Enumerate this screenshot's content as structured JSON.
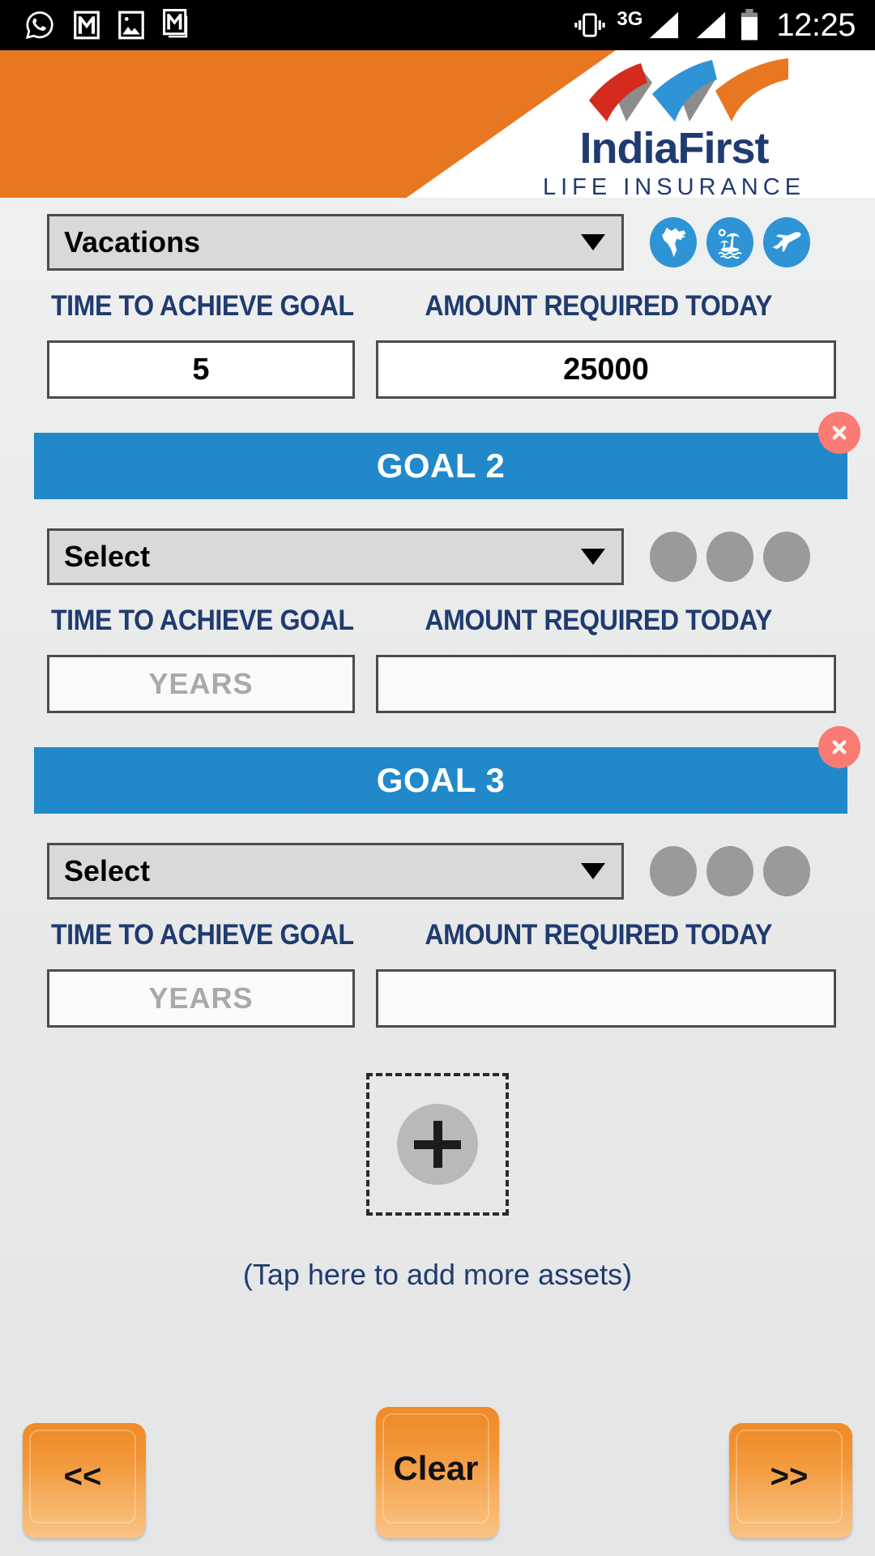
{
  "statusbar": {
    "time": "12:25",
    "network": "3G",
    "left_icons": [
      "whatsapp-icon",
      "gmail-icon",
      "gallery-icon",
      "gmail-icon"
    ],
    "right_icons": [
      "vibrate-icon",
      "signal-icon",
      "signal-icon",
      "battery-icon"
    ]
  },
  "header": {
    "brand_name": "IndiaFirst",
    "brand_sub": "LIFE INSURANCE",
    "accent_orange": "#e87722",
    "accent_navy": "#1f3b70",
    "logo_colors": [
      "#d52b1e",
      "#2f94d6",
      "#e87722",
      "#8c8c8c"
    ]
  },
  "labels": {
    "time_to_achieve": "TIME TO ACHIEVE GOAL",
    "amount_required": "AMOUNT REQUIRED TODAY"
  },
  "goals": [
    {
      "banner": null,
      "select_value": "Vacations",
      "icons": [
        "india-map-icon",
        "beach-island-icon",
        "airplane-icon"
      ],
      "icons_filled": true,
      "years_value": "5",
      "years_placeholder": "",
      "amount_value": "25000",
      "amount_placeholder": ""
    },
    {
      "banner": "GOAL 2",
      "select_value": "Select",
      "icons": [
        "placeholder-circle-icon",
        "placeholder-circle-icon",
        "placeholder-circle-icon"
      ],
      "icons_filled": false,
      "years_value": "",
      "years_placeholder": "YEARS",
      "amount_value": "",
      "amount_placeholder": ""
    },
    {
      "banner": "GOAL 3",
      "select_value": "Select",
      "icons": [
        "placeholder-circle-icon",
        "placeholder-circle-icon",
        "placeholder-circle-icon"
      ],
      "icons_filled": false,
      "years_value": "",
      "years_placeholder": "YEARS",
      "amount_value": "",
      "amount_placeholder": ""
    }
  ],
  "add_asset": {
    "plus_icon": "plus-icon",
    "hint": "(Tap here to add more assets)"
  },
  "footer": {
    "prev_label": "<<",
    "clear_label": "Clear",
    "next_label": ">>",
    "button_color": "#f29434"
  },
  "colors": {
    "banner_blue": "#2189ca",
    "close_red": "#fa7a74",
    "icon_blue": "#2f94d6",
    "placeholder_gray": "#9a9a9a"
  }
}
